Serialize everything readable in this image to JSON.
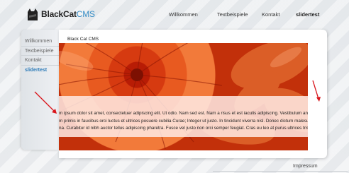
{
  "brand": {
    "name": "BlackCat",
    "suffix": "CMS"
  },
  "topnav": {
    "items": [
      "Willkommen",
      "Textbeispiele",
      "Kontakt",
      "slidertest"
    ]
  },
  "sidebar": {
    "items": [
      {
        "label": "Willkommen",
        "active": false
      },
      {
        "label": "Textbeispiele",
        "active": false
      },
      {
        "label": "Kontakt",
        "active": false
      },
      {
        "label": "slidertest",
        "active": true
      }
    ]
  },
  "content": {
    "title": "Black Cat CMS",
    "hero_lines": [
      "m ipsum dolor sit amet, consectetuer adipiscing elit. Ut odio. Nam sed est. Nam a risus et est iaculis adipiscing. Vestibulum ante",
      "m primis in faucibus orci luctus et ultrices posuere cubilia Curae; Integer ut justo. In tincidunt viverra nisl. Donec dictum malesuada",
      "na. Curabitur id nibh auctor tellus adipiscing pharetra. Fusce vel justo non orci semper feugiat. Cras eu leo at purus ultrices tristique."
    ]
  },
  "footer": {
    "link": "Impressum"
  },
  "colors": {
    "accent": "#2a7ab8",
    "cms_blue": "#3a8fc7",
    "arrow_red": "#d9161c"
  }
}
